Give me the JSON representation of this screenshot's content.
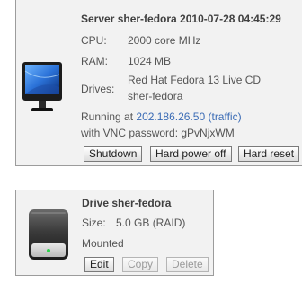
{
  "server": {
    "title": "Server sher-fedora 2010-07-28 04:45:29",
    "cpu_label": "CPU:",
    "cpu_value": "2000 core MHz",
    "ram_label": "RAM:",
    "ram_value": "1024 MB",
    "drives_label": "Drives:",
    "drives_line1": "Red Hat Fedora 13 Live CD",
    "drives_line2": "sher-fedora",
    "running_prefix": "Running at ",
    "ip": "202.186.26.50",
    "traffic": "(traffic)",
    "vnc_text": "with VNC password: gPvNjxWM",
    "buttons": {
      "shutdown": "Shutdown",
      "hard_power_off": "Hard power off",
      "hard_reset": "Hard reset"
    },
    "icon": "monitor-icon"
  },
  "drive": {
    "title": "Drive sher-fedora",
    "size_label": "Size:",
    "size_value": "5.0 GB (RAID)",
    "status": "Mounted",
    "buttons": {
      "edit": "Edit",
      "copy": "Copy",
      "delete": "Delete"
    },
    "icon": "hard-drive-icon"
  },
  "colors": {
    "panel_bg": "#f2f2f2",
    "border": "#9c9c9c",
    "link": "#3a6bb5"
  }
}
